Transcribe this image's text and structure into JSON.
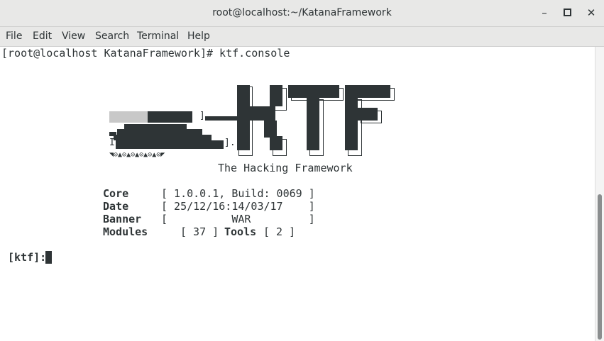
{
  "window": {
    "title": "root@localhost:~/KatanaFramework",
    "minimize_icon": "minimize-icon",
    "maximize_icon": "maximize-icon",
    "close_icon": "close-icon"
  },
  "menubar": {
    "items": [
      "File",
      "Edit",
      "View",
      "Search",
      "Terminal",
      "Help"
    ]
  },
  "terminal": {
    "prompt_line": "[root@localhost KatanaFramework]# ktf.console",
    "banner_art": {
      "logo_text": "KTF",
      "tank_wheels": "◥⊙▲⊙▲⊙▲⊙▲⊙▲⊙◤",
      "tank_bracket_1": "]",
      "tank_bracket_2": "I",
      "tank_bracket_3": "]."
    },
    "subtitle": "The Hacking Framework",
    "info": [
      {
        "label": "Core",
        "value": "[ 1.0.0.1, Build: 0069 ]"
      },
      {
        "label": "Date",
        "value": "[ 25/12/16:14/03/17    ]"
      },
      {
        "label": "Banner",
        "value": "[          WAR         ]"
      }
    ],
    "modules_label": "Modules",
    "modules_value": "[ 37 ]",
    "tools_label": "Tools",
    "tools_value": "[ 2 ]",
    "ktf_prompt": "[ktf]:"
  }
}
